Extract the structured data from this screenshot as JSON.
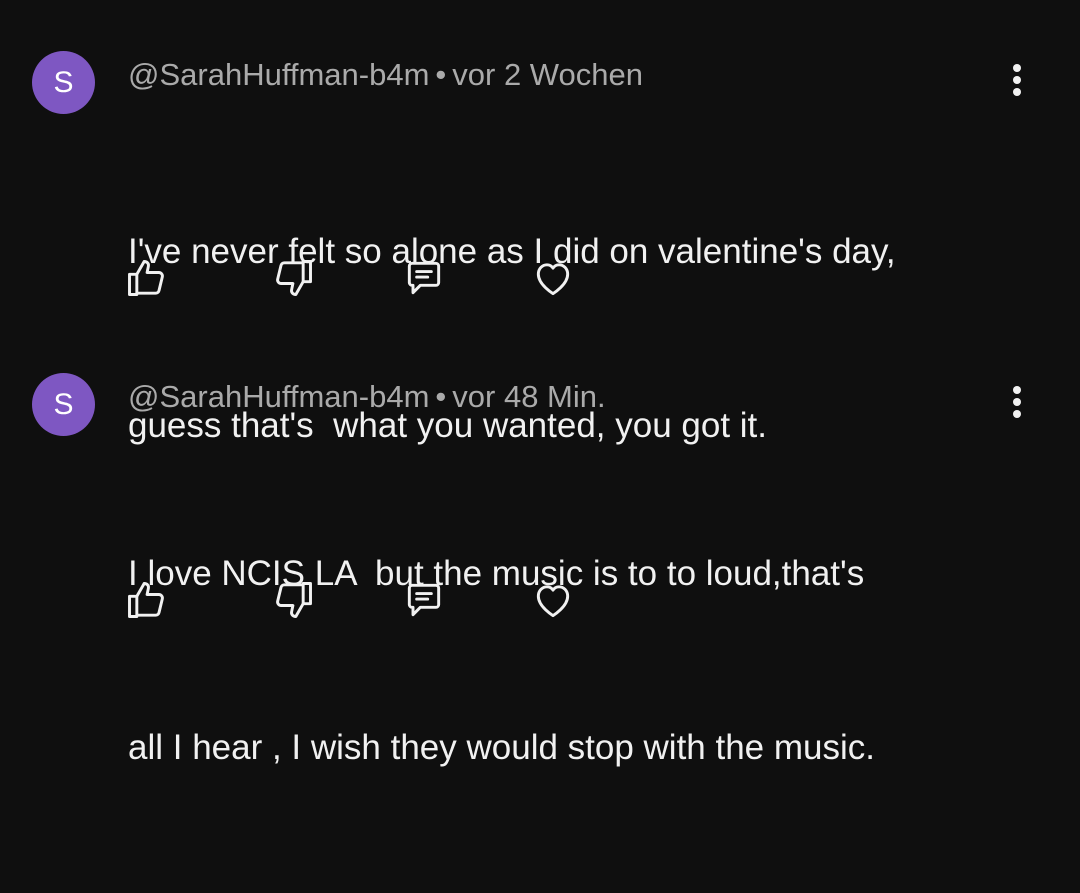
{
  "colors": {
    "background": "#0f0f0f",
    "avatar": "#7e57c2",
    "text_primary": "#f1f1f1",
    "text_secondary": "#aaaaaa"
  },
  "comments": [
    {
      "avatar_letter": "S",
      "author": "@SarahHuffman-b4m",
      "separator": "•",
      "time": "vor 2 Wochen",
      "lines": [
        "I've never felt so alone as I did on valentine's day,",
        "guess that's  what you wanted, you got it."
      ],
      "icons": [
        "thumbs-up-icon",
        "thumbs-down-icon",
        "reply-icon",
        "heart-icon",
        "more-vert-icon"
      ]
    },
    {
      "avatar_letter": "S",
      "author": "@SarahHuffman-b4m",
      "separator": "•",
      "time": "vor 48 Min.",
      "lines": [
        "I love NCIS LA  but the music is to to loud,that's",
        "all I hear , I wish they would stop with the music."
      ],
      "icons": [
        "thumbs-up-icon",
        "thumbs-down-icon",
        "reply-icon",
        "heart-icon",
        "more-vert-icon"
      ]
    }
  ]
}
